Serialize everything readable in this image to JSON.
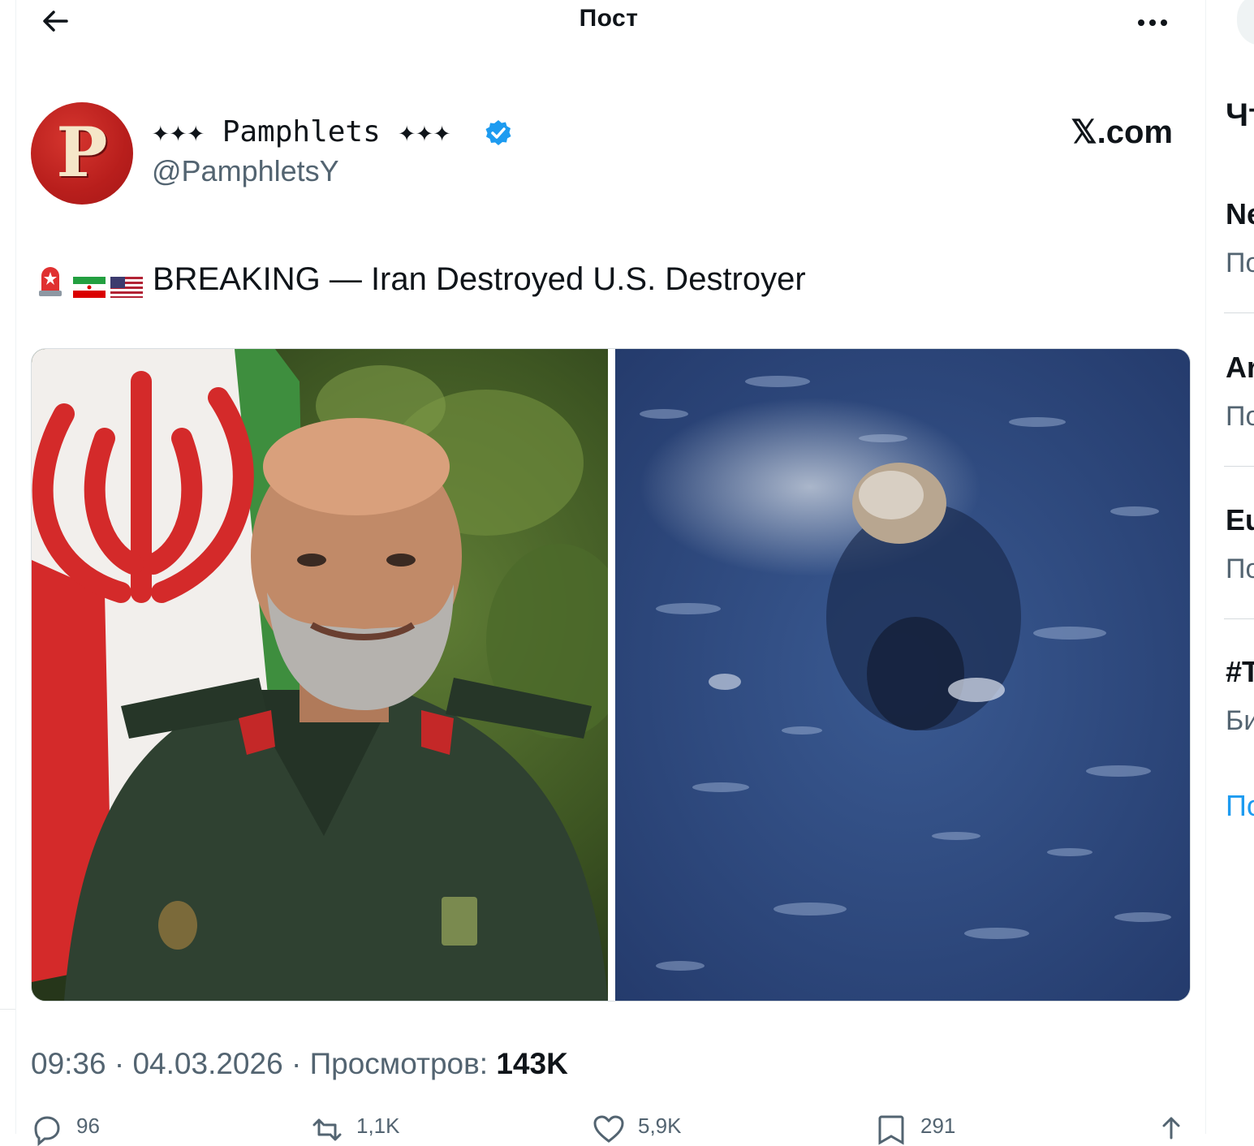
{
  "header": {
    "title": "Пост"
  },
  "author": {
    "display_name": "✦✦✦ Pamphlets ✦✦✦",
    "handle": "@PamphletsY",
    "avatar_letter": "P",
    "verified": true
  },
  "source": "𝕏.com",
  "tweet": {
    "text": "BREAKING — Iran Destroyed U.S. Destroyer"
  },
  "meta": {
    "time": "09:36",
    "date": "04.03.2026",
    "views_label": "Просмотров:",
    "views_count": "143K"
  },
  "actions": {
    "replies": "96",
    "reposts": "1,1K",
    "likes": "5,9K",
    "bookmarks": "291"
  },
  "sidebar": {
    "heading": "Чт",
    "trends": [
      {
        "title": "Ne",
        "sub": "По"
      },
      {
        "title": "Ar",
        "sub": "По"
      },
      {
        "title": "Eu",
        "sub": "По"
      },
      {
        "title": "#T",
        "sub": "Би"
      }
    ],
    "show_more": "По"
  },
  "colors": {
    "accent": "#1d9bf0",
    "secondary_text": "#536471",
    "avatar_bg": "#c0211f"
  }
}
